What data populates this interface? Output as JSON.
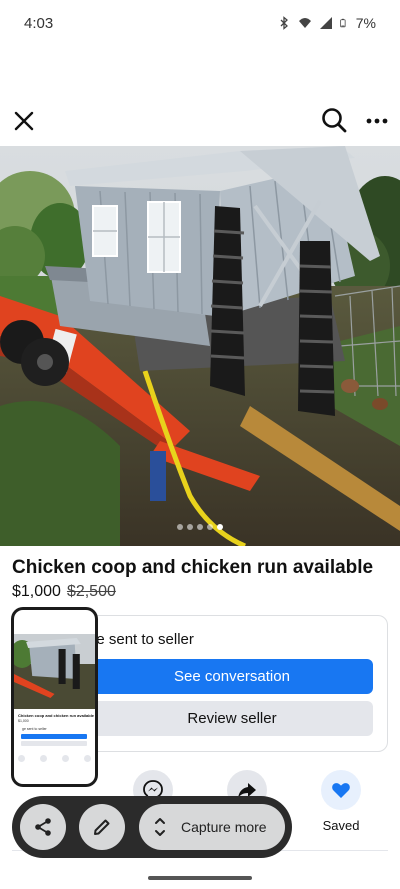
{
  "status_bar": {
    "time": "4:03",
    "battery": "7%"
  },
  "nav": {
    "close_icon": "close-icon",
    "search_icon": "search-icon",
    "more_icon": "more-icon"
  },
  "hero": {
    "image_count": 5,
    "active_index": 4
  },
  "listing": {
    "title": "Chicken coop and chicken run available",
    "price": "$1,000",
    "original_price": "$2,500"
  },
  "message_card": {
    "status_text": "ge sent to seller",
    "see_conversation": "See conversation",
    "review_seller": "Review seller"
  },
  "actions": {
    "saved_label": "Saved"
  },
  "screenshot_toolbar": {
    "capture_more": "Capture more"
  },
  "colors": {
    "accent": "#1877f2",
    "secondary_button": "#e4e6eb",
    "toolbar": "#2b2b2b"
  }
}
